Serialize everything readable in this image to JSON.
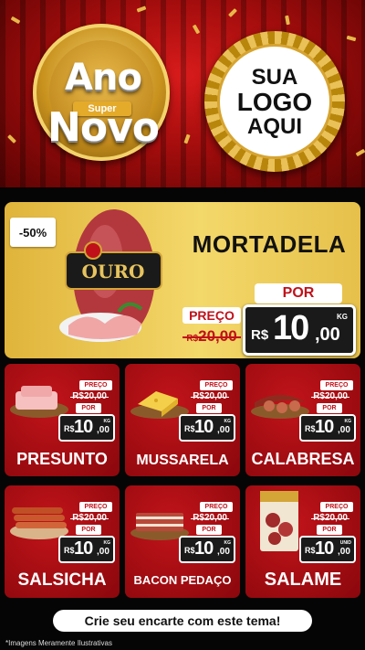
{
  "header": {
    "badge_word_1": "Ano",
    "badge_pill": "Super",
    "badge_word_2": "Novo",
    "logo_line_1": "SUA",
    "logo_line_2": "LOGO",
    "logo_line_3": "AQUI"
  },
  "featured": {
    "discount": "-50%",
    "name": "MORTADELA",
    "brand_text": "OURO",
    "preco_label": "PREÇO",
    "old_currency": "R$",
    "old_price": "20,00",
    "por_label": "POR",
    "currency": "R$",
    "price_int": "10",
    "price_dec": ",00",
    "unit": "KG"
  },
  "products": [
    {
      "name": "PRESUNTO",
      "preco_label": "PREÇO",
      "old_price": "R$20,00",
      "por_label": "POR",
      "currency": "R$",
      "price_int": "10",
      "price_dec": ",00",
      "unit": "KG"
    },
    {
      "name": "MUSSARELA",
      "preco_label": "PREÇO",
      "old_price": "R$20,00",
      "por_label": "POR",
      "currency": "R$",
      "price_int": "10",
      "price_dec": ",00",
      "unit": "KG"
    },
    {
      "name": "CALABRESA",
      "preco_label": "PREÇO",
      "old_price": "R$20,00",
      "por_label": "POR",
      "currency": "R$",
      "price_int": "10",
      "price_dec": ",00",
      "unit": "KG"
    },
    {
      "name": "SALSICHA",
      "preco_label": "PREÇO",
      "old_price": "R$20,00",
      "por_label": "POR",
      "currency": "R$",
      "price_int": "10",
      "price_dec": ",00",
      "unit": "KG"
    },
    {
      "name": "BACON PEDAÇO",
      "preco_label": "PREÇO",
      "old_price": "R$20,00",
      "por_label": "POR",
      "currency": "R$",
      "price_int": "10",
      "price_dec": ",00",
      "unit": "KG"
    },
    {
      "name": "SALAME",
      "preco_label": "PREÇO",
      "old_price": "R$20,00",
      "por_label": "POR",
      "currency": "R$",
      "price_int": "10",
      "price_dec": ",00",
      "unit": "UNID"
    }
  ],
  "footer": {
    "cta": "Crie seu encarte com este tema!",
    "disclaimer": "*Imagens Meramente Ilustrativas"
  },
  "colors": {
    "brand_red": "#c0111a",
    "gold": "#e6c04a",
    "price_dark": "#1a1a1a"
  }
}
